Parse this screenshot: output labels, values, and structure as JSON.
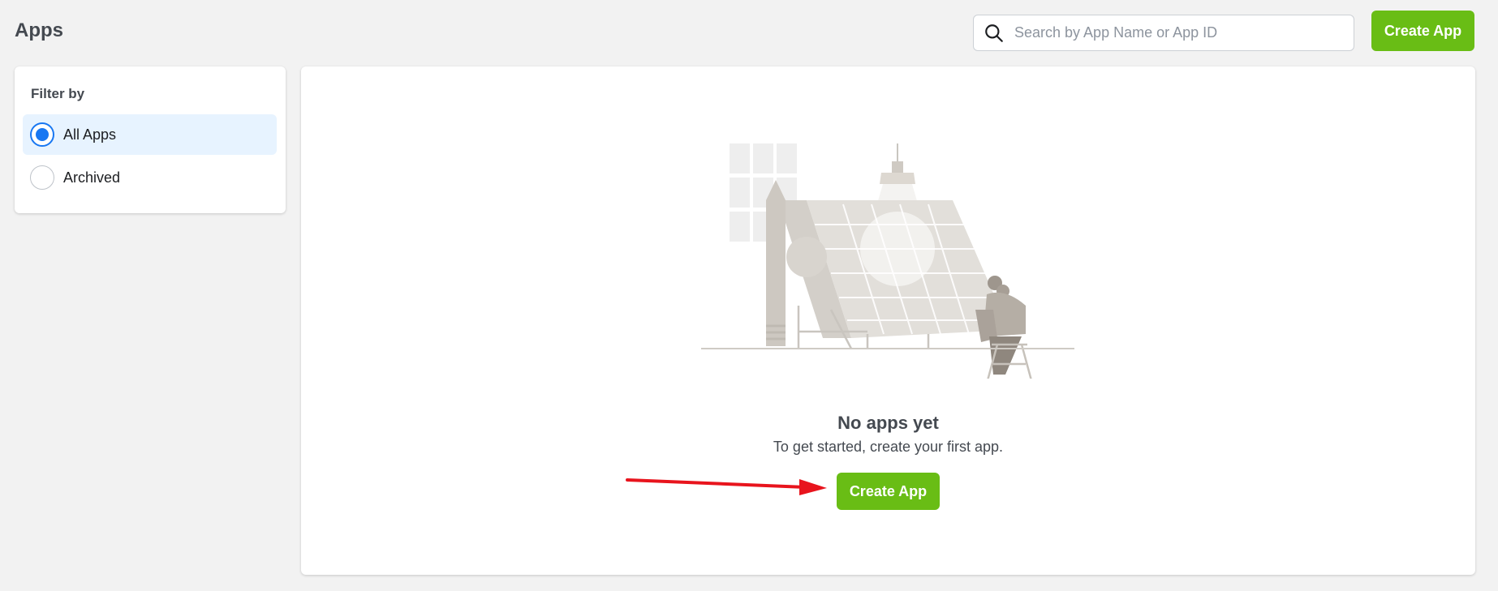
{
  "header": {
    "title": "Apps",
    "search": {
      "placeholder": "Search by App Name or App ID",
      "value": "",
      "icon": "search-icon"
    },
    "create_button": "Create App"
  },
  "filter": {
    "title": "Filter by",
    "options": [
      {
        "label": "All Apps",
        "selected": true
      },
      {
        "label": "Archived",
        "selected": false
      }
    ]
  },
  "empty_state": {
    "illustration": "person-at-drafting-table-illustration",
    "title": "No apps yet",
    "subtitle": "To get started, create your first app.",
    "button": "Create App"
  },
  "colors": {
    "accent_green": "#69bd15",
    "selected_blue": "#1877f2",
    "selected_bg": "#e7f3ff",
    "annotation_arrow": "#e8141d"
  }
}
